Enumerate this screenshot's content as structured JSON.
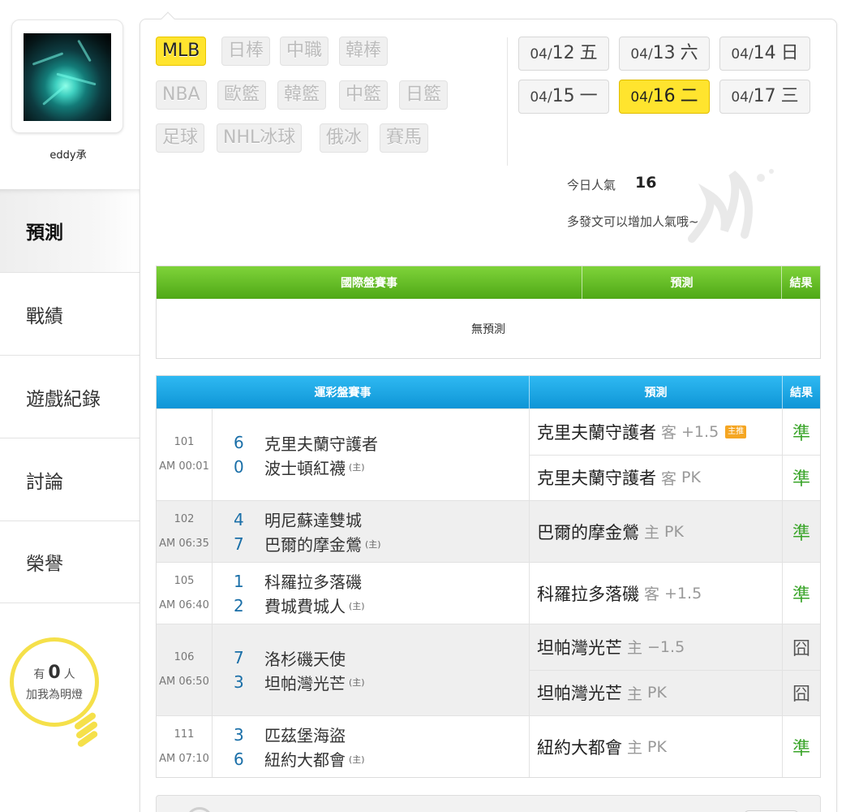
{
  "user": {
    "name": "eddy承"
  },
  "sidebar": {
    "items": [
      {
        "label": "預測"
      },
      {
        "label": "戰績"
      },
      {
        "label": "遊戲紀錄"
      },
      {
        "label": "討論"
      },
      {
        "label": "榮譽"
      }
    ],
    "bulb": {
      "prefix": "有",
      "count": "0",
      "suffix": "人",
      "line2": "加我為明燈"
    }
  },
  "sports": [
    "MLB",
    "日棒",
    "中職",
    "韓棒",
    "NBA",
    "歐籃",
    "韓籃",
    "中籃",
    "日籃",
    "足球",
    "NHL冰球",
    "俄冰",
    "賽馬"
  ],
  "dates": [
    {
      "md": "04/",
      "d": "12",
      "wk": "五"
    },
    {
      "md": "04/",
      "d": "13",
      "wk": "六"
    },
    {
      "md": "04/",
      "d": "14",
      "wk": "日"
    },
    {
      "md": "04/",
      "d": "15",
      "wk": "一"
    },
    {
      "md": "04/",
      "d": "16",
      "wk": "二"
    },
    {
      "md": "04/",
      "d": "17",
      "wk": "三"
    }
  ],
  "popularity": {
    "label": "今日人氣",
    "count": "16",
    "note": "多發文可以增加人氣哦~"
  },
  "intl_table": {
    "headers": [
      "國際盤賽事",
      "預測",
      "結果"
    ],
    "empty": "無預測"
  },
  "sports_lottery_table": {
    "headers": [
      "運彩盤賽事",
      "預測",
      "結果"
    ],
    "games": [
      {
        "no": "101",
        "time": "AM 00:01",
        "teams": [
          {
            "score": "6",
            "name": "克里夫蘭守護者",
            "home": ""
          },
          {
            "score": "0",
            "name": "波士頓紅襪",
            "home": "(主)"
          }
        ],
        "preds": [
          {
            "team": "克里夫蘭守護者",
            "side": "客",
            "line": "+1.5",
            "tag": "主推",
            "result": "準"
          },
          {
            "team": "克里夫蘭守護者",
            "side": "客",
            "line": "PK",
            "tag": "",
            "result": "準"
          }
        ]
      },
      {
        "no": "102",
        "time": "AM 06:35",
        "teams": [
          {
            "score": "4",
            "name": "明尼蘇達雙城",
            "home": ""
          },
          {
            "score": "7",
            "name": "巴爾的摩金鶯",
            "home": "(主)"
          }
        ],
        "preds": [
          {
            "team": "巴爾的摩金鶯",
            "side": "主",
            "line": "PK",
            "tag": "",
            "result": "準"
          }
        ]
      },
      {
        "no": "105",
        "time": "AM 06:40",
        "teams": [
          {
            "score": "1",
            "name": "科羅拉多落磯",
            "home": ""
          },
          {
            "score": "2",
            "name": "費城費城人",
            "home": "(主)"
          }
        ],
        "preds": [
          {
            "team": "科羅拉多落磯",
            "side": "客",
            "line": "+1.5",
            "tag": "",
            "result": "準"
          }
        ]
      },
      {
        "no": "106",
        "time": "AM 06:50",
        "teams": [
          {
            "score": "7",
            "name": "洛杉磯天使",
            "home": ""
          },
          {
            "score": "3",
            "name": "坦帕灣光芒",
            "home": "(主)"
          }
        ],
        "preds": [
          {
            "team": "坦帕灣光芒",
            "side": "主",
            "line": "−1.5",
            "tag": "",
            "result": "囧"
          },
          {
            "team": "坦帕灣光芒",
            "side": "主",
            "line": "PK",
            "tag": "",
            "result": "囧"
          }
        ]
      },
      {
        "no": "111",
        "time": "AM 07:10",
        "teams": [
          {
            "score": "3",
            "name": "匹茲堡海盜",
            "home": ""
          },
          {
            "score": "6",
            "name": "紐約大都會",
            "home": "(主)"
          }
        ],
        "preds": [
          {
            "team": "紐約大都會",
            "side": "主",
            "line": "PK",
            "tag": "",
            "result": "準"
          }
        ]
      }
    ]
  },
  "colors": {
    "accent_yellow": "#ffe42e",
    "header_green": "#5cb51f",
    "header_blue": "#1aa3e2",
    "win_green": "#3aa52a",
    "score_blue": "#1a6fa8"
  }
}
